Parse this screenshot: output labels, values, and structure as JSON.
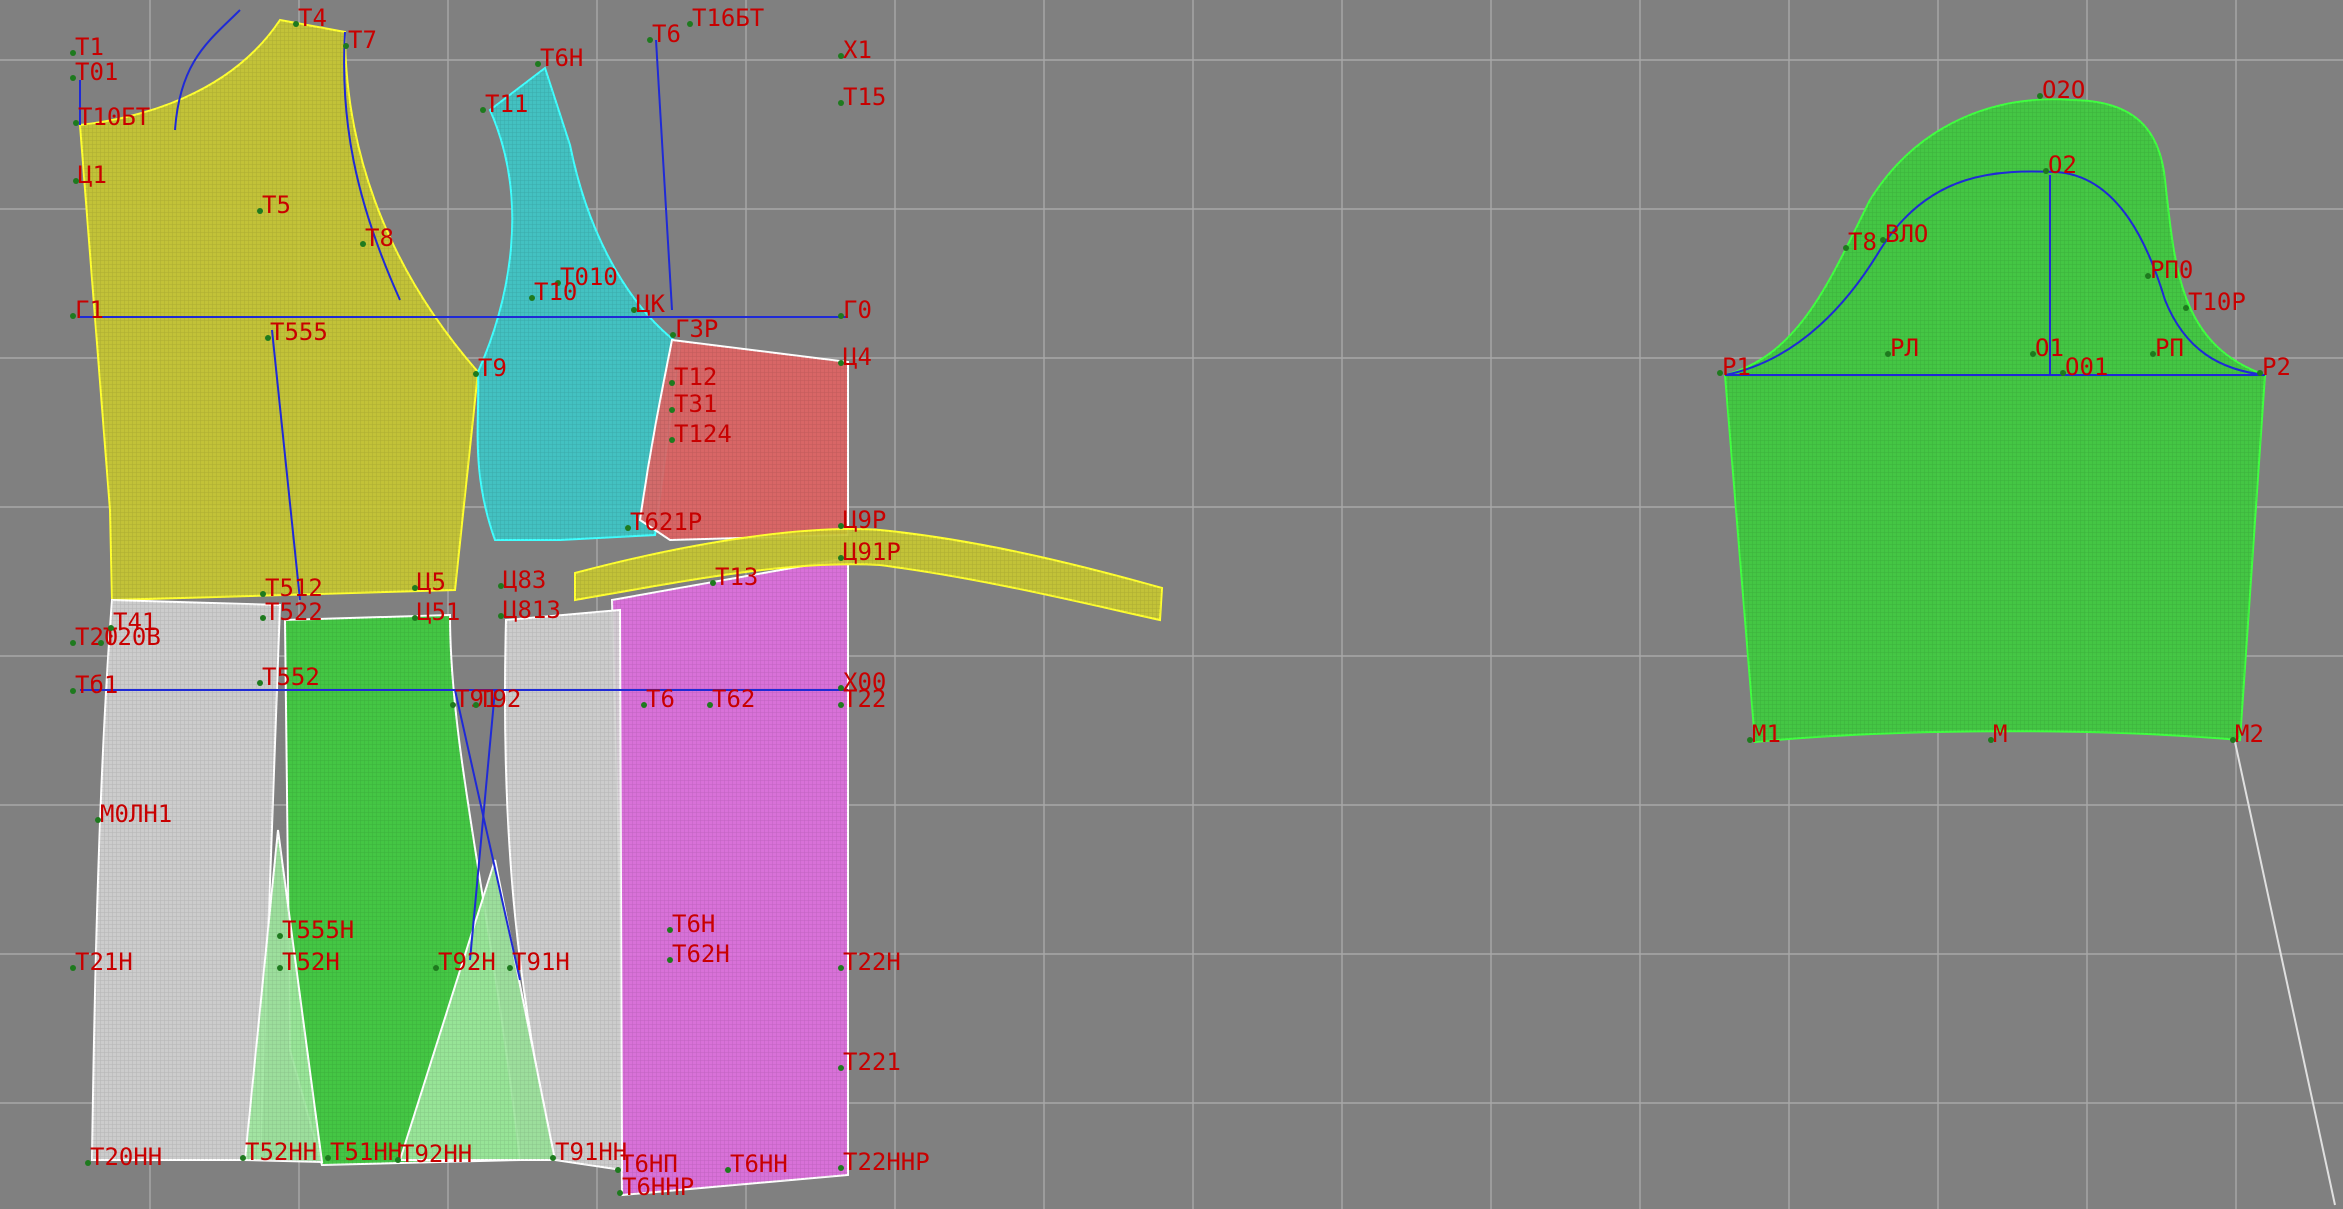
{
  "colors": {
    "background": "#808080",
    "grid": "#a8a8a8",
    "label": "#c80000",
    "construction_line": "#1f2ad6",
    "point": "#1e7a1e",
    "piece_yellow": "#c8c832",
    "piece_cyan": "#3ec7c7",
    "piece_red": "#e06464",
    "piece_magenta": "#e070e0",
    "piece_green": "#3fcc3f",
    "piece_light_green": "#9ee69e",
    "piece_white": "#d2d2d2",
    "outline_yellow": "#ffff30",
    "outline_cyan": "#40ffff",
    "outline_white": "#ffffff",
    "outline_green": "#40ff40"
  },
  "pieces": [
    {
      "id": "back-yoke-upper",
      "color": "piece_yellow"
    },
    {
      "id": "front-upper",
      "color": "piece_cyan"
    },
    {
      "id": "side-red",
      "color": "piece_red"
    },
    {
      "id": "front-lower",
      "color": "piece_magenta"
    },
    {
      "id": "belt-strip",
      "color": "piece_yellow"
    },
    {
      "id": "back-lower-left",
      "color": "piece_white"
    },
    {
      "id": "back-lower-middle",
      "color": "piece_green"
    },
    {
      "id": "side-lower",
      "color": "piece_white"
    },
    {
      "id": "godet-left",
      "color": "piece_light_green"
    },
    {
      "id": "godet-right",
      "color": "piece_light_green"
    },
    {
      "id": "sleeve",
      "color": "piece_green"
    }
  ],
  "labels": [
    {
      "text": "Т1"
    },
    {
      "text": "Т01"
    },
    {
      "text": "Т10БТ"
    },
    {
      "text": "Ц1"
    },
    {
      "text": "Т5"
    },
    {
      "text": "Т7"
    },
    {
      "text": "Т4"
    },
    {
      "text": "Т8"
    },
    {
      "text": "Г1"
    },
    {
      "text": "Т555"
    },
    {
      "text": "Т9"
    },
    {
      "text": "Т11"
    },
    {
      "text": "Т6"
    },
    {
      "text": "Т16БТ"
    },
    {
      "text": "Т6Н"
    },
    {
      "text": "Х1"
    },
    {
      "text": "Т15"
    },
    {
      "text": "Т010"
    },
    {
      "text": "Т10"
    },
    {
      "text": "ЦК"
    },
    {
      "text": "Г3Р"
    },
    {
      "text": "Г0"
    },
    {
      "text": "Ц4"
    },
    {
      "text": "Т12"
    },
    {
      "text": "Т31"
    },
    {
      "text": "Т124"
    },
    {
      "text": "Т621Р"
    },
    {
      "text": "Ц9Р"
    },
    {
      "text": "Ц91Р"
    },
    {
      "text": "Т512"
    },
    {
      "text": "Т522"
    },
    {
      "text": "Ц5"
    },
    {
      "text": "Ц51"
    },
    {
      "text": "Ц83"
    },
    {
      "text": "Ц813"
    },
    {
      "text": "Т13"
    },
    {
      "text": "Т20"
    },
    {
      "text": "Т20В"
    },
    {
      "text": "Т41"
    },
    {
      "text": "Т552"
    },
    {
      "text": "Тб1"
    },
    {
      "text": "Т91"
    },
    {
      "text": "Т92"
    },
    {
      "text": "Т6"
    },
    {
      "text": "Т62"
    },
    {
      "text": "Х00"
    },
    {
      "text": "Т22"
    },
    {
      "text": "М0ЛН1"
    },
    {
      "text": "Т555Н"
    },
    {
      "text": "Т52Н"
    },
    {
      "text": "Т92Н"
    },
    {
      "text": "Т91Н"
    },
    {
      "text": "Т6Н"
    },
    {
      "text": "Т62Н"
    },
    {
      "text": "Т22Н"
    },
    {
      "text": "Т21Н"
    },
    {
      "text": "Т221"
    },
    {
      "text": "Т20НН"
    },
    {
      "text": "Т52НН"
    },
    {
      "text": "Т51НН"
    },
    {
      "text": "Т92НН"
    },
    {
      "text": "Т91НН"
    },
    {
      "text": "Т6НП"
    },
    {
      "text": "Т6НН"
    },
    {
      "text": "Т22ННР"
    },
    {
      "text": "Т6ННР"
    },
    {
      "text": "О2О"
    },
    {
      "text": "О2"
    },
    {
      "text": "Т8"
    },
    {
      "text": "ВЛО"
    },
    {
      "text": "РП0"
    },
    {
      "text": "Т10Р"
    },
    {
      "text": "Р1"
    },
    {
      "text": "РЛ"
    },
    {
      "text": "О1"
    },
    {
      "text": "О01"
    },
    {
      "text": "РП"
    },
    {
      "text": "Р2"
    },
    {
      "text": "М1"
    },
    {
      "text": "М"
    },
    {
      "text": "М2"
    }
  ]
}
